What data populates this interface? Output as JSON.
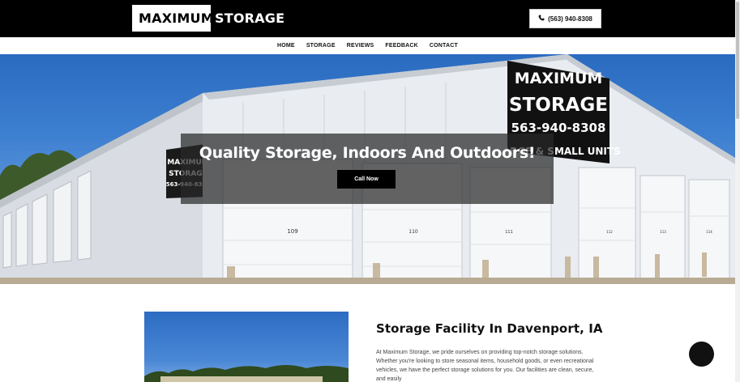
{
  "header": {
    "logo_boxed": "MAXIMUM",
    "logo_text": "STORAGE",
    "phone_label": "(563) 940-8308"
  },
  "nav": {
    "items": [
      "HOME",
      "STORAGE",
      "REVIEWS",
      "FEEDBACK",
      "CONTACT"
    ]
  },
  "hero": {
    "title": "Quality Storage, Indoors And Outdoors!",
    "cta_label": "Call Now",
    "building_sign_lines": [
      "MAXIMUM",
      "STORAGE",
      "563-940-8308",
      "LARGE & SMALL UNITS"
    ],
    "side_sign_lines": [
      "MAXIMUM",
      "STORAGE",
      "563-940-8308"
    ],
    "unit_numbers": [
      "109",
      "110",
      "111",
      "112",
      "113",
      "114"
    ]
  },
  "section": {
    "title": "Storage Facility In Davenport, IA",
    "body": "At Maximum Storage, we pride ourselves on providing top-notch storage solutions. Whether you're looking to store seasonal items, household goods, or even recreational vehicles, we have the perfect storage solutions for you. Our facilities are clean, secure, and easily"
  },
  "colors": {
    "header_bg": "#000000",
    "cta_bg": "#000000",
    "sky": "#3d7fd0",
    "building": "#e8ebef"
  },
  "icons": {
    "phone": "phone-icon",
    "chat": "chat-icon"
  }
}
